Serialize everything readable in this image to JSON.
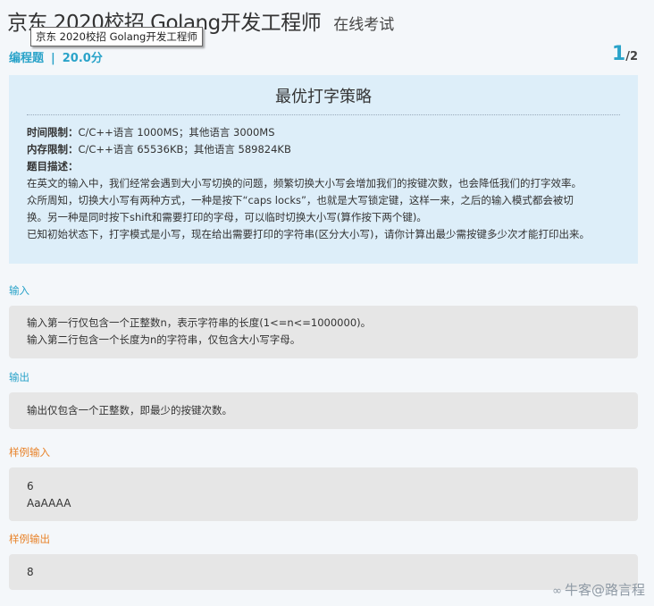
{
  "header": {
    "title": "京东 2020校招 Golang开发工程师",
    "subtitle": "在线考试",
    "tooltip": "京东 2020校招    Golang开发工程师"
  },
  "meta": {
    "type": "编程题",
    "separator": "|",
    "score": "20.0分",
    "page_current": "1",
    "page_total": "/2"
  },
  "problem": {
    "title": "最优打字策略",
    "time_limit_label": "时间限制：",
    "time_limit": "C/C++语言 1000MS；其他语言 3000MS",
    "memory_limit_label": "内存限制：",
    "memory_limit": "C/C++语言 65536KB；其他语言 589824KB",
    "desc_label": "题目描述：",
    "desc_lines": [
      "在英文的输入中，我们经常会遇到大小写切换的问题，频繁切换大小写会增加我们的按键次数，也会降低我们的打字效率。",
      "众所周知，切换大小写有两种方式，一种是按下“caps locks”，也就是大写锁定键，这样一来，之后的输入模式都会被切",
      "换。另一种是同时按下shift和需要打印的字母，可以临时切换大小写(算作按下两个键)。",
      "已知初始状态下，打字模式是小写，现在给出需要打印的字符串(区分大小写)，请你计算出最少需按键多少次才能打印出来。"
    ]
  },
  "input_section": {
    "label": "输入",
    "lines": [
      "输入第一行仅包含一个正整数n，表示字符串的长度(1<=n<=1000000)。",
      "输入第二行包含一个长度为n的字符串，仅包含大小写字母。"
    ]
  },
  "output_section": {
    "label": "输出",
    "lines": [
      "输出仅包含一个正整数，即最少的按键次数。"
    ]
  },
  "sample_input": {
    "label": "样例输入",
    "lines": [
      "6",
      "AaAAAA"
    ]
  },
  "sample_output": {
    "label": "样例输出",
    "lines": [
      "8"
    ]
  },
  "watermark": {
    "icon": "wechat-icon",
    "text": "牛客@路言程"
  }
}
